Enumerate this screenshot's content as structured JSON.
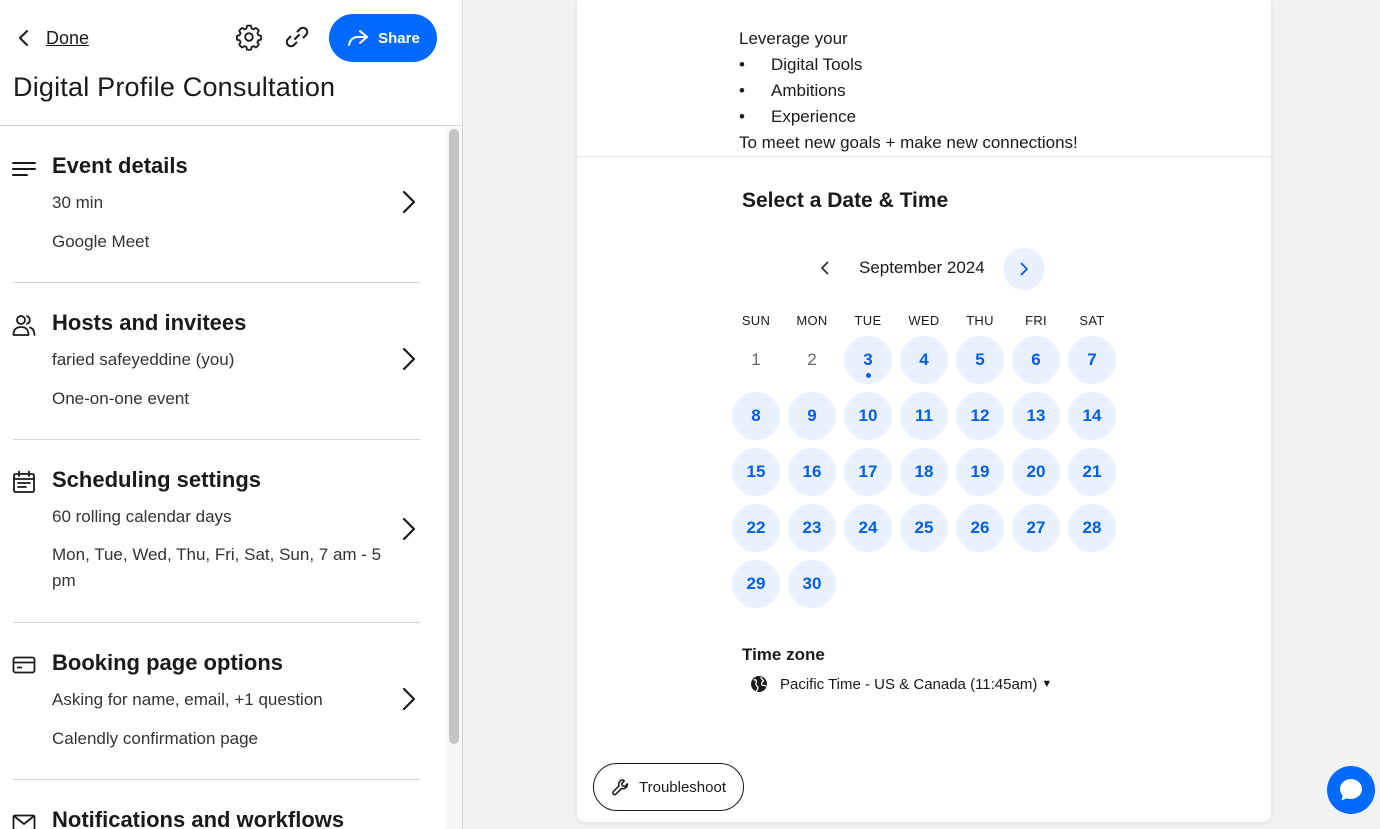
{
  "header": {
    "back_label": "Done",
    "share_label": "Share",
    "title": "Digital Profile Consultation"
  },
  "sections": [
    {
      "icon": "lines-icon",
      "title": "Event details",
      "lines": [
        "30 min",
        "Google Meet"
      ]
    },
    {
      "icon": "people-icon",
      "title": "Hosts and invitees",
      "lines": [
        "faried safeyeddine (you)",
        "One-on-one event"
      ]
    },
    {
      "icon": "calendar-icon",
      "title": "Scheduling settings",
      "lines": [
        "60 rolling calendar days",
        "Mon, Tue, Wed, Thu, Fri, Sat, Sun, 7 am - 5 pm"
      ]
    },
    {
      "icon": "card-icon",
      "title": "Booking page options",
      "lines": [
        "Asking for name, email, +1 question",
        "Calendly confirmation page"
      ]
    },
    {
      "icon": "mail-icon",
      "title": "Notifications and workflows",
      "lines": []
    }
  ],
  "preview": {
    "description": {
      "intro": "Leverage your",
      "bullets": [
        "Digital Tools",
        "Ambitions",
        "Experience"
      ],
      "outro": "To meet new goals + make new connections!"
    },
    "select_title": "Select a Date & Time",
    "month_label": "September 2024",
    "weekdays": [
      "SUN",
      "MON",
      "TUE",
      "WED",
      "THU",
      "FRI",
      "SAT"
    ],
    "days": [
      [
        "1",
        "2",
        "3",
        "4",
        "5",
        "6",
        "7"
      ],
      [
        "8",
        "9",
        "10",
        "11",
        "12",
        "13",
        "14"
      ],
      [
        "15",
        "16",
        "17",
        "18",
        "19",
        "20",
        "21"
      ],
      [
        "22",
        "23",
        "24",
        "25",
        "26",
        "27",
        "28"
      ],
      [
        "29",
        "30"
      ]
    ],
    "unavailable_days": [
      "1",
      "2"
    ],
    "today": "3",
    "timezone_title": "Time zone",
    "timezone_label": "Pacific Time - US & Canada (11:45am)"
  },
  "troubleshoot_label": "Troubleshoot",
  "colors": {
    "accent": "#0069ff",
    "day_text": "#0060e6",
    "day_bg": "#e9f1ff"
  }
}
